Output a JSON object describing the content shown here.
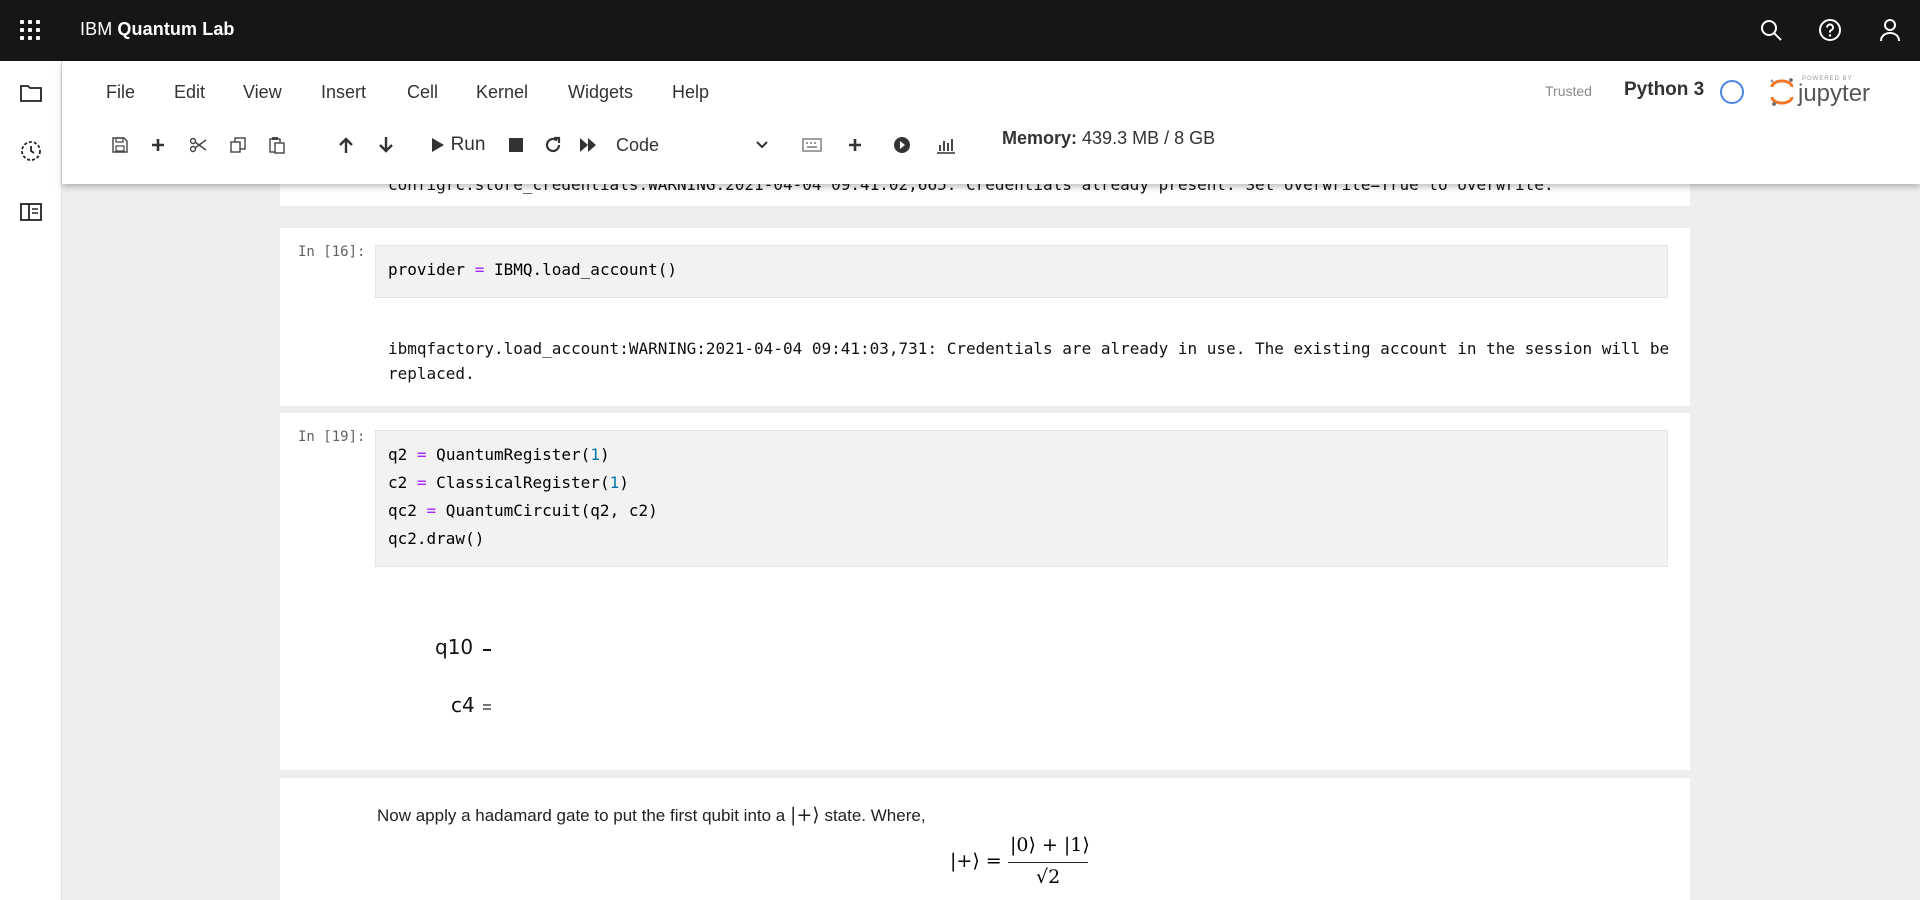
{
  "header": {
    "brand_prefix": "IBM",
    "brand_name": "Quantum Lab",
    "icons": [
      "app-switcher-icon",
      "search-icon",
      "help-icon",
      "user-icon"
    ]
  },
  "siderail": {
    "icons": [
      "folder-icon",
      "history-icon",
      "panel-icon"
    ]
  },
  "menubar": {
    "items": [
      "File",
      "Edit",
      "View",
      "Insert",
      "Cell",
      "Kernel",
      "Widgets",
      "Help"
    ]
  },
  "kernel": {
    "trusted_label": "Trusted",
    "name": "Python 3",
    "logo_text": "jupyter",
    "logo_small": "POWERED BY"
  },
  "toolbar": {
    "run_label": "Run",
    "cell_type": "Code",
    "memory_label": "Memory:",
    "memory_value": "439.3 MB / 8 GB"
  },
  "cells": {
    "prev_output": "configrc.store_credentials:WARNING:2021-04-04 09:41:02,665: Credentials already present. Set overwrite=True to overwrite.",
    "cell16": {
      "prompt": "In [16]:",
      "output": "ibmqfactory.load_account:WARNING:2021-04-04 09:41:03,731: Credentials are already in use. The existing account in the session will be replaced."
    },
    "cell19": {
      "prompt": "In [19]:",
      "circuit_q": "q10",
      "circuit_c": "c4"
    },
    "markdown": {
      "text_before": "Now apply a hadamard gate to put the first qubit into a",
      "ket_plus": "|+⟩",
      "text_after": "state. Where,",
      "eq_lhs": "|+⟩ =",
      "eq_numerator": "|0⟩ + |1⟩",
      "eq_denominator": "√2"
    }
  }
}
